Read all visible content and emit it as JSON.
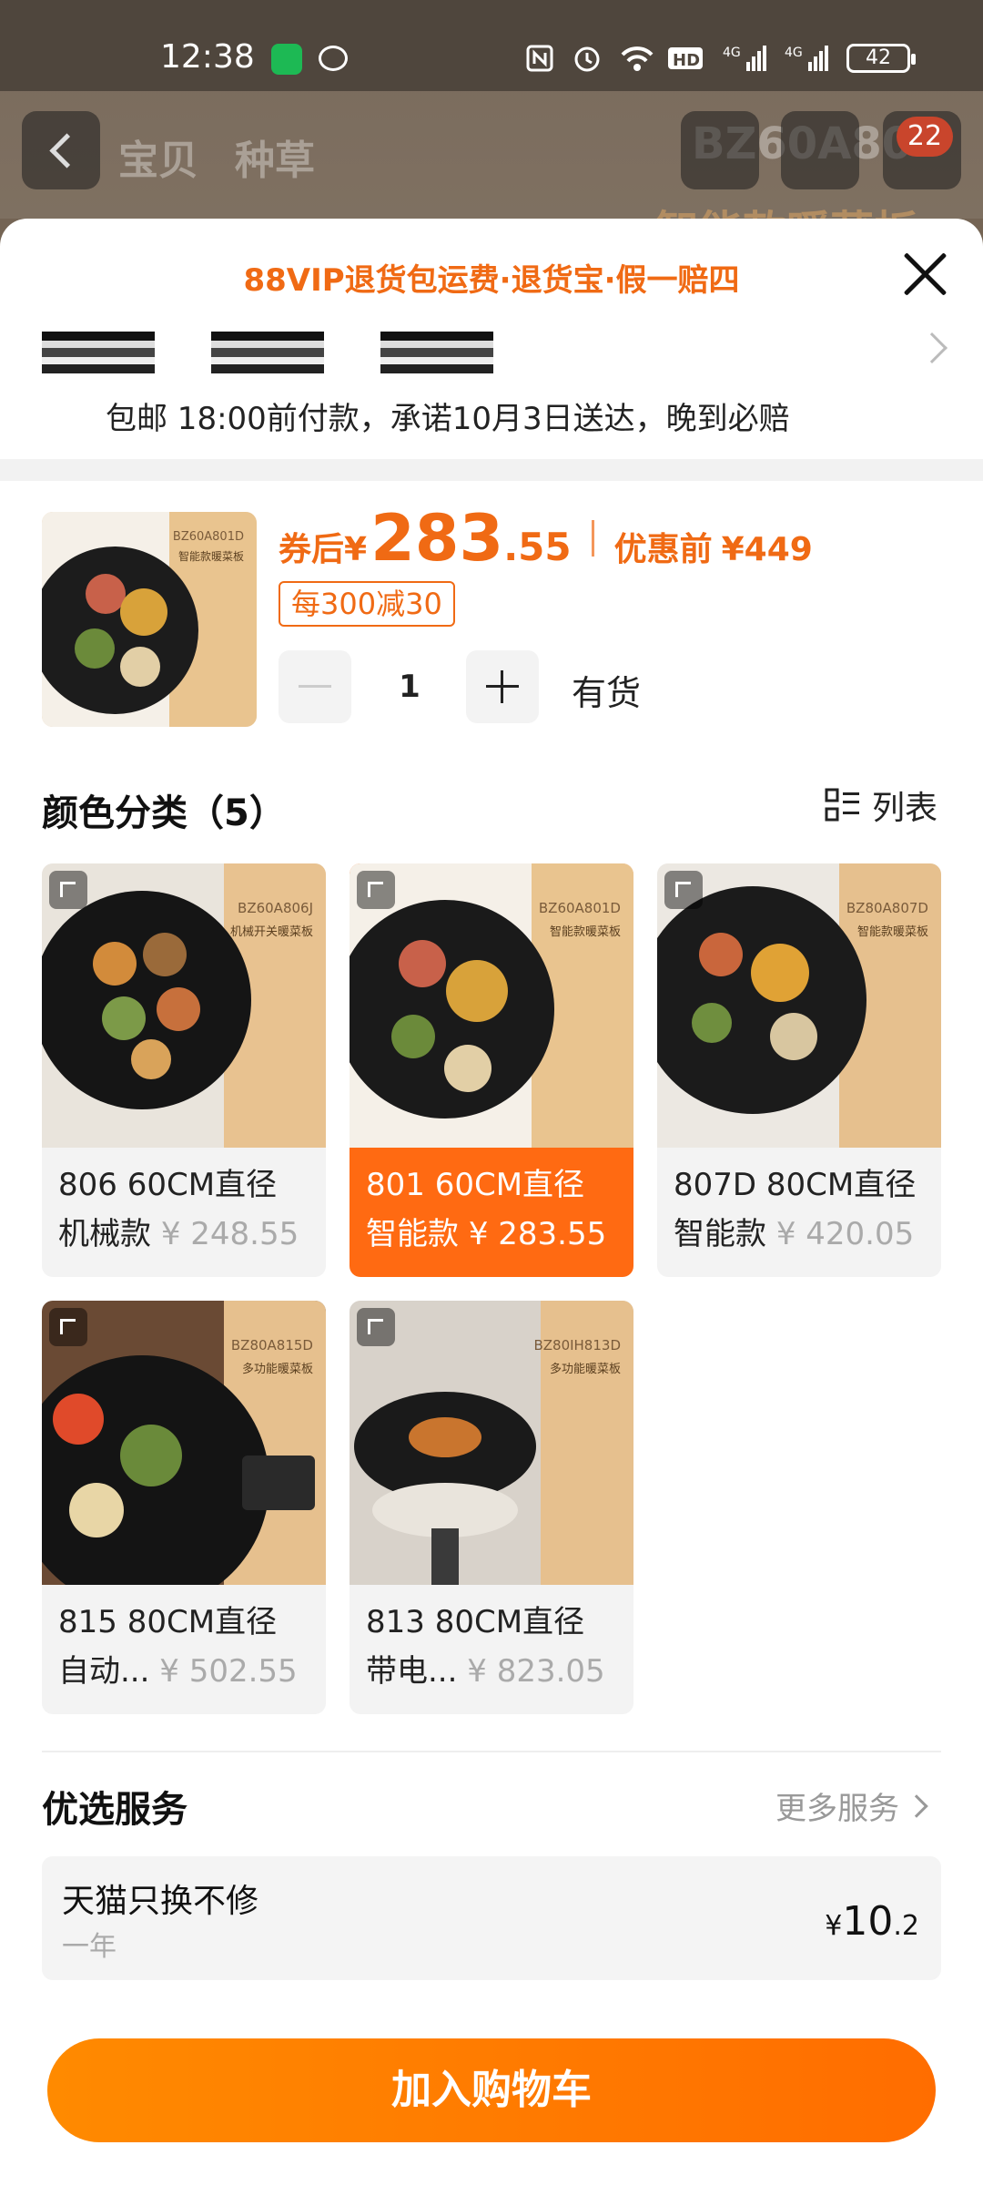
{
  "status_bar": {
    "time": "12:38",
    "battery": "42"
  },
  "background": {
    "tabs": [
      "宝贝",
      "种草"
    ],
    "title_fragment": "BZ60A80",
    "subtitle_fragment": "智能款暖菜板",
    "cart_badge": "22"
  },
  "sheet": {
    "promo": "88VIP退货包运费·退货宝·假一赔四",
    "delivery": "包邮 18:00前付款，承诺10月3日送达，晚到必赔",
    "product": {
      "price_label": "券后",
      "currency": "¥",
      "price_int": "283",
      "price_dec": ".55",
      "orig_label": "优惠前",
      "orig_price": "¥449",
      "coupon": "每300减30",
      "quantity": "1",
      "stock": "有货",
      "thumb": {
        "model": "BZ60A801D",
        "name": "智能款暖菜板"
      }
    },
    "variants_title": "颜色分类（5）",
    "list_toggle": "列表",
    "variants": [
      {
        "line1": "806 60CM直径",
        "line2": "机械款",
        "price": "¥ 248.55",
        "model": "BZ60A806J",
        "name": "机械开关暖菜板",
        "selected": false
      },
      {
        "line1": "801 60CM直径",
        "line2": "智能款",
        "price": "¥ 283.55",
        "model": "BZ60A801D",
        "name": "智能款暖菜板",
        "selected": true
      },
      {
        "line1": "807D 80CM直径",
        "line2": "智能款",
        "price": "¥ 420.05",
        "model": "BZ80A807D",
        "name": "智能款暖菜板",
        "selected": false
      },
      {
        "line1": "815 80CM直径",
        "line2": "自动...",
        "price": "¥ 502.55",
        "model": "BZ80A815D",
        "name": "多功能暖菜板",
        "selected": false
      },
      {
        "line1": "813 80CM直径",
        "line2": "带电...",
        "price": "¥ 823.05",
        "model": "BZ80IH813D",
        "name": "多功能暖菜板",
        "selected": false
      }
    ],
    "services_title": "优选服务",
    "more_services": "更多服务",
    "service": {
      "name": "天猫只换不修",
      "term": "一年",
      "currency": "¥",
      "price_main": "10",
      "price_dec": ".2"
    },
    "add_to_cart": "加入购物车"
  },
  "colors": {
    "accent": "#f06a14",
    "selected": "#ff6a12",
    "button": "#ff7a00"
  }
}
